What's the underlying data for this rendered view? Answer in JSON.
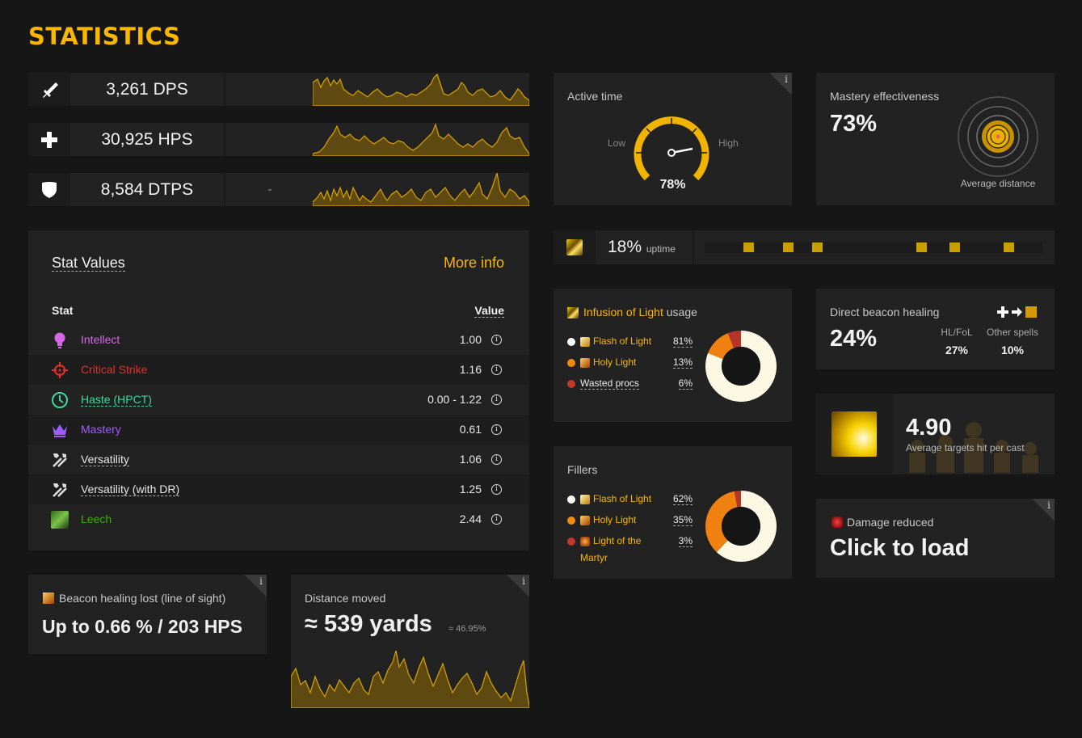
{
  "page_title": "STATISTICS",
  "perf": [
    {
      "value": "3,261 DPS",
      "mid": "",
      "icon": "sword-icon"
    },
    {
      "value": "30,925 HPS",
      "mid": "",
      "icon": "healing-cross-icon"
    },
    {
      "value": "8,584 DTPS",
      "mid": "-",
      "icon": "shield-icon"
    }
  ],
  "active_time": {
    "label": "Active time",
    "low": "Low",
    "high": "High",
    "value": "78%",
    "fraction": 0.78,
    "info": "i"
  },
  "mastery": {
    "label": "Mastery effectiveness",
    "value": "73%",
    "sublabel": "Average distance"
  },
  "uptime": {
    "value": "18%",
    "label": "uptime"
  },
  "stat_values": {
    "title": "Stat Values",
    "more_info": "More info",
    "col_stat": "Stat",
    "col_value": "Value",
    "rows": [
      {
        "name": "Intellect",
        "value": "1.00",
        "color": "#d667e6",
        "icon": "lightbulb-icon"
      },
      {
        "name": "Critical Strike",
        "value": "1.16",
        "color": "#e0302b",
        "icon": "crosshair-icon"
      },
      {
        "name": "Haste (HPCT)",
        "value": "0.00 - 1.22",
        "color": "#3fd6a0",
        "icon": "clock-icon"
      },
      {
        "name": "Mastery",
        "value": "0.61",
        "color": "#9e5cff",
        "icon": "crown-icon"
      },
      {
        "name": "Versatility",
        "value": "1.06",
        "color": "#e6e6e6",
        "icon": "tools-icon"
      },
      {
        "name": "Versatility (with DR)",
        "value": "1.25",
        "color": "#e6e6e6",
        "icon": "tools-icon"
      },
      {
        "name": "Leech",
        "value": "2.44",
        "color": "#3ab000",
        "icon": "leech-icon"
      }
    ]
  },
  "infusion": {
    "title_prefix": "Infusion of Light",
    "title_suffix": "usage",
    "items": [
      {
        "name": "Flash of Light",
        "pct": "81%",
        "dot": "#ffffff",
        "value": 81,
        "color": "#fdf8e4"
      },
      {
        "name": "Holy Light",
        "pct": "13%",
        "dot": "#f28a10",
        "value": 13,
        "color": "#f08010"
      },
      {
        "name": "Wasted procs",
        "pct": "6%",
        "dot": "#c0392b",
        "value": 6,
        "color": "#b4352a"
      }
    ]
  },
  "fillers": {
    "title": "Fillers",
    "items": [
      {
        "name": "Flash of Light",
        "pct": "62%",
        "dot": "#ffffff",
        "value": 62,
        "color": "#fdf8e4"
      },
      {
        "name": "Holy Light",
        "pct": "35%",
        "dot": "#f28a10",
        "value": 35,
        "color": "#f08010"
      },
      {
        "name": "Light of the Martyr",
        "name_line1": "Light of the",
        "name_line2": "Martyr",
        "pct": "3%",
        "dot": "#c0392b",
        "value": 3,
        "color": "#b4352a"
      }
    ]
  },
  "beacon_direct": {
    "label": "Direct beacon healing",
    "value": "24%",
    "col1": "HL/FoL",
    "col2": "Other spells",
    "val1": "27%",
    "val2": "10%"
  },
  "targets": {
    "value": "4.90",
    "label": "Average targets hit per cast"
  },
  "damage_reduced": {
    "label": "Damage reduced",
    "value": "Click to load",
    "info": "i"
  },
  "beacon_lost": {
    "label": "Beacon healing lost (line of sight)",
    "value": "Up to 0.66 % / 203 HPS",
    "info": "i"
  },
  "distance": {
    "label": "Distance moved",
    "value": "≈ 539 yards",
    "sub": "≈ 46.95%",
    "info": "i"
  }
}
